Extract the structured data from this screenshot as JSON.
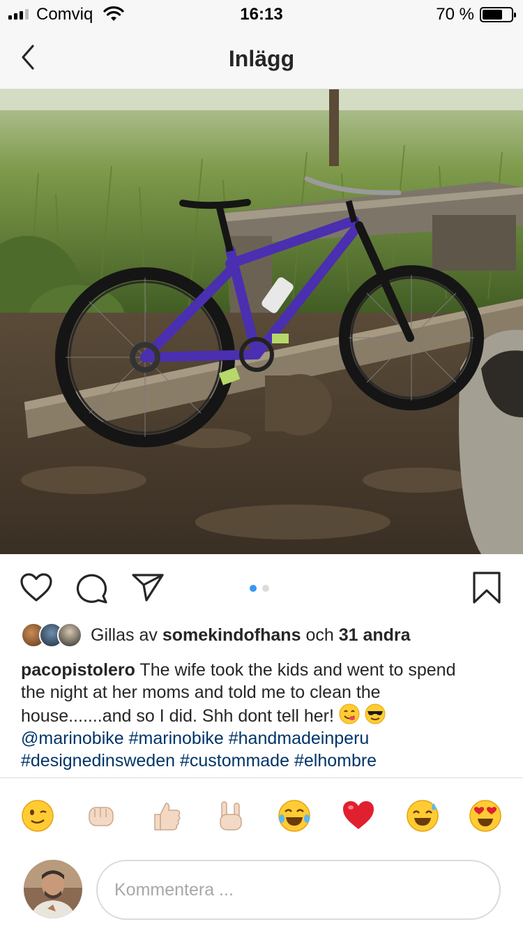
{
  "status_bar": {
    "carrier": "Comviq",
    "time": "16:13",
    "battery_percent": "70 %",
    "battery_level": 0.7,
    "signal_bars": 3
  },
  "nav": {
    "title": "Inlägg",
    "back_icon": "chevron-left-icon"
  },
  "post": {
    "image_icon": "photo",
    "carousel": {
      "count": 2,
      "active_index": 0
    },
    "actions": {
      "like_icon": "heart-icon",
      "comment_icon": "speech-bubble-icon",
      "share_icon": "paper-plane-icon",
      "save_icon": "bookmark-icon"
    },
    "likes": {
      "prefix": "Gillas av",
      "first_user": "somekindofhans",
      "joiner": "och",
      "others": "31 andra"
    },
    "caption": {
      "username": "pacopistolero",
      "text": "The wife took the kids and went to spend the night at her moms and told me to clean the house.......and so I did. Shh dont tell her!",
      "mention": "@marinobike",
      "hashtags_line1": [
        "#marinobike",
        "#handmadeinperu"
      ],
      "hashtags_line2": [
        "#designedinsweden",
        "#custommade",
        "#elhombre"
      ]
    }
  },
  "emoji_bar": [
    "winking-face",
    "fist-bump",
    "thumbs-up",
    "rock-on",
    "tears-of-joy",
    "red-heart",
    "sweat-smile",
    "heart-eyes"
  ],
  "composer": {
    "placeholder": "Kommentera ..."
  },
  "colors": {
    "link": "#003569",
    "active_dot": "#3897f0",
    "divider": "#dbdbdb"
  }
}
